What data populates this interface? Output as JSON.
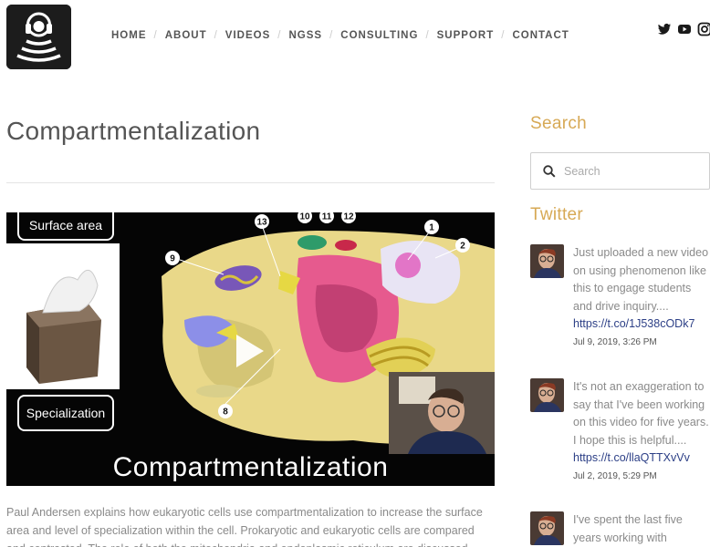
{
  "nav": {
    "items": [
      "HOME",
      "ABOUT",
      "VIDEOS",
      "NGSS",
      "CONSULTING",
      "SUPPORT",
      "CONTACT"
    ]
  },
  "social": {
    "icons": [
      "twitter-icon",
      "youtube-icon",
      "instagram-icon"
    ]
  },
  "main": {
    "title": "Compartmentalization",
    "video": {
      "overlay_title": "Compartmentalization",
      "left_label_top": "Surface area",
      "left_label_bottom": "Specialization",
      "diagram_numbers": [
        "13",
        "10",
        "11",
        "12",
        "1",
        "2",
        "9",
        "8"
      ]
    },
    "description": "Paul Andersen explains how eukaryotic cells use compartmentalization to increase the surface area and level of specialization within the cell. Prokaryotic and eukaryotic cells are compared and contrasted. The role of both the mitochondria and endoplasmic reticulum are discussed."
  },
  "sidebar": {
    "search_title": "Search",
    "search_placeholder": "Search",
    "twitter_title": "Twitter",
    "tweets": [
      {
        "text": "Just uploaded a new video on using phenomenon like this to engage students and drive inquiry....",
        "link": "https://t.co/1J538cODk7",
        "date": "Jul 9, 2019, 3:26 PM"
      },
      {
        "text": "It's not an exaggeration to say that I've been working on this video for five years. I hope this is helpful....",
        "link": "https://t.co/llaQTTXvVv",
        "date": "Jul 2, 2019, 5:29 PM"
      },
      {
        "text": "I've spent the last five years working with",
        "link": "",
        "date": ""
      }
    ]
  },
  "colors": {
    "accent": "#d7a955",
    "link": "#2c3f86",
    "text": "#555555",
    "muted": "#8a8a8a"
  }
}
